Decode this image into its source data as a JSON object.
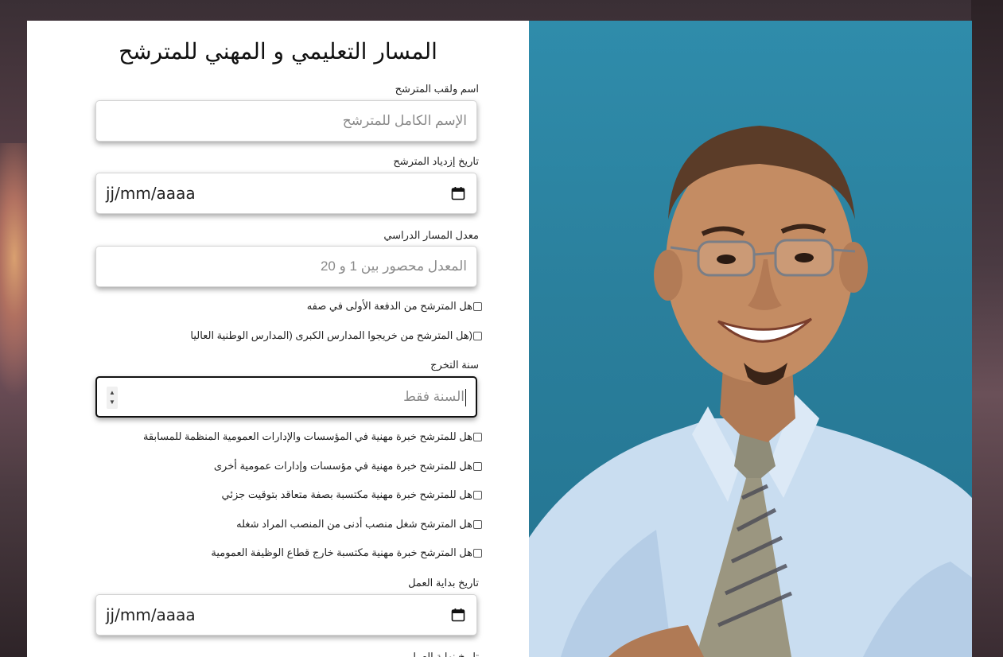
{
  "form": {
    "title": "المسار التعليمي و المهني للمترشح",
    "name_label": "اسم ولقب المترشح",
    "name_placeholder": "الإسم الكامل للمترشح",
    "birth_label": "تاريخ إزدياد المترشح",
    "birth_value": "jj/mm/aaaa",
    "avg_label": "معدل المسار الدراسي",
    "avg_placeholder": "المعدل محصور بين 1 و 20",
    "check_first_batch": "هل المترشح من الدفعة الأولى في صفه",
    "check_grandes_ecoles": "(هل المترشح من خريجوا المدارس الكبرى (المدارس الوطنية العاليا",
    "grad_year_label": "سنة التخرج",
    "grad_year_placeholder": "السنة فقط",
    "check_exp_public": "هل للمترشح خبرة مهنية في المؤسسات والإدارات العمومية المنظمة للمسابقة",
    "check_exp_other_public": "هل للمترشح خبرة مهنية في مؤسسات وإدارات عمومية أخرى",
    "check_exp_contract": "هل للمترشح خبرة مهنية مكتسبة بصفة متعاقد بتوقيت جزئي",
    "check_lower_post": "هل المترشح شغل منصب أدنى من المنصب المراد شغله",
    "check_exp_private": "هل المترشح خبرة مهنية مكتسبة خارج قطاع الوظيفة العمومية",
    "work_start_label": "تاريخ بداية العمل",
    "work_start_value": "jj/mm/aaaa",
    "next_label_partial": "تاريخ نهاية العمل"
  },
  "colors": {
    "photo_bg": "#2a7f9c",
    "card_bg": "#ffffff"
  }
}
